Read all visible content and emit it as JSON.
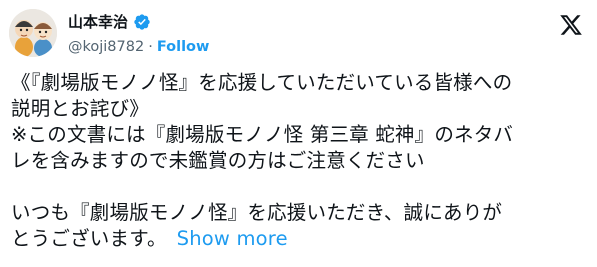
{
  "author": {
    "display_name": "山本幸治",
    "handle": "@koji8782",
    "separator": "·",
    "follow_label": "Follow",
    "verified_icon": "verified-badge-icon",
    "avatar_icon": "avatar-figurines"
  },
  "platform_icon": "x-logo-icon",
  "tweet": {
    "lines": [
      "《『劇場版モノノ怪』を応援していただいている皆様への",
      "説明とお詫び》",
      "※この文書には『劇場版モノノ怪 第三章 蛇神』のネタバ",
      "レを含みますので未鑑賞の方はご注意ください",
      "いつも『劇場版モノノ怪』を応援いただき、誠にありが",
      "とうございます。"
    ],
    "show_more_label": "Show more"
  },
  "colors": {
    "accent": "#1d9bf0",
    "text": "#0f1419",
    "muted": "#536471"
  }
}
